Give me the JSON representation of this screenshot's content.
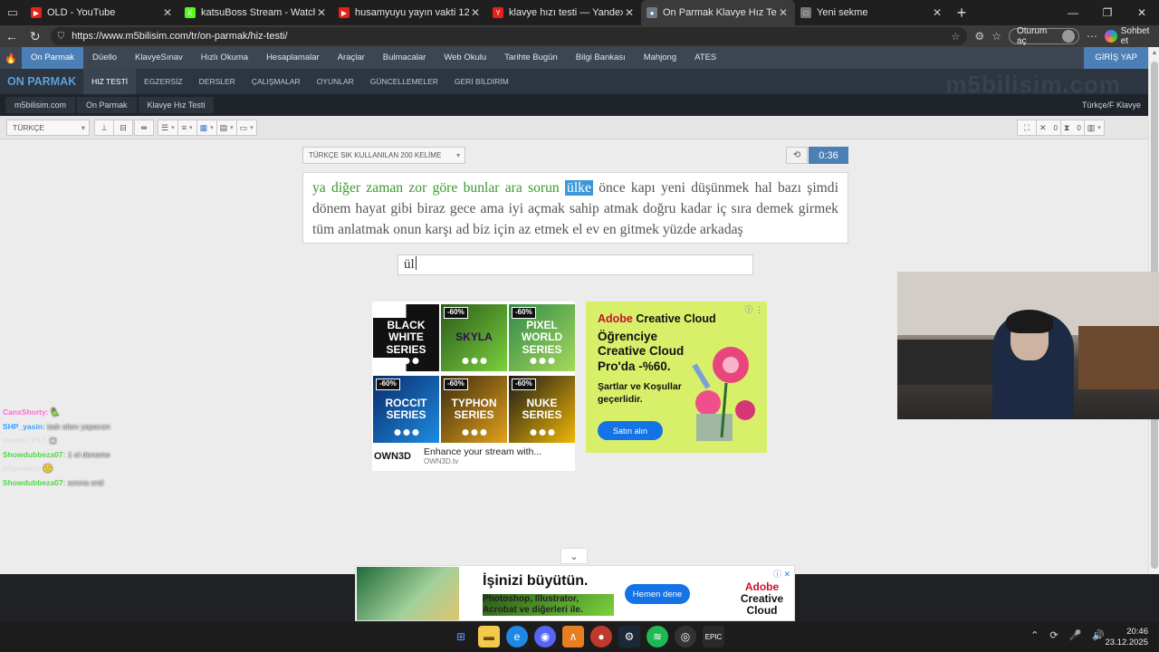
{
  "browser": {
    "tabs": [
      {
        "title": "OLD - YouTube",
        "fav_color": "#e62117",
        "fav": "▶",
        "active": false
      },
      {
        "title": "katsuBoss Stream - Watch Live on",
        "fav_color": "#53fc18",
        "fav": "K",
        "active": false
      },
      {
        "title": "husamyuyu yayın vakti 12 - YouTu",
        "fav_color": "#e62117",
        "fav": "▶",
        "active": false
      },
      {
        "title": "klavye hızı testi — Yandex: 104 bin",
        "fav_color": "#e62117",
        "fav": "Y",
        "active": false
      },
      {
        "title": "On Parmak Klavye Hız Testi | m5bi",
        "fav_color": "#6b7b8c",
        "fav": "●",
        "active": true
      },
      {
        "title": "Yeni sekme",
        "fav_color": "#777777",
        "fav": "□",
        "active": false
      }
    ],
    "url": "https://www.m5bilisim.com/tr/on-parmak/hiz-testi/",
    "signin_label": "Oturum aç",
    "copilot_label": "Sohbet et"
  },
  "site": {
    "menu": [
      "On Parmak",
      "Düello",
      "KlavyeSınav",
      "Hızlı Okuma",
      "Hesaplamalar",
      "Araçlar",
      "Bulmacalar",
      "Web Okulu",
      "Tarihte Bugün",
      "Bilgi Bankası",
      "Mahjong",
      "ATES"
    ],
    "login": "GİRİŞ YAP",
    "brand": "ON PARMAK",
    "subnav": [
      "HIZ TESTİ",
      "EGZERSİZ",
      "DERSLER",
      "ÇALIŞMALAR",
      "OYUNLAR",
      "GÜNCELLEMELER",
      "GERİ BİLDİRİM"
    ],
    "watermark": "m5bilisim.com",
    "breadcrumb": [
      "m5bilisim.com",
      "On Parmak",
      "Klavye Hız Testi"
    ],
    "keyboard_label": "Türkçe/F Klavye"
  },
  "toolbar": {
    "language": "TÜRKÇE",
    "counter_errors": "0",
    "counter_time": "0"
  },
  "test": {
    "word_set": "TÜRKÇE SIK KULLANILAN 200 KELİME",
    "timer": "0:36",
    "typed_words": [
      "ya",
      "diğer",
      "zaman",
      "zor",
      "göre",
      "bunlar",
      "ara",
      "sorun"
    ],
    "current_word": "ülke",
    "pending_words": [
      "önce",
      "kapı",
      "yeni",
      "düşünmek",
      "hal",
      "bazı",
      "şimdi",
      "dönem",
      "hayat",
      "gibi",
      "biraz",
      "gece",
      "ama",
      "iyi",
      "açmak",
      "sahip",
      "atmak",
      "doğru",
      "kadar",
      "iç",
      "sıra",
      "demek",
      "girmek",
      "tüm",
      "anlatmak",
      "onun",
      "karşı",
      "ad",
      "biz",
      "için",
      "az",
      "etmek",
      "el",
      "ev",
      "en",
      "gitmek",
      "yüzde",
      "arkadaş"
    ],
    "input_value": "ül"
  },
  "ads": {
    "own3d": {
      "tiles": [
        {
          "label": "BLACK WHITE SERIES",
          "pct": ""
        },
        {
          "label": "SKYLA",
          "pct": "-60%"
        },
        {
          "label": "PIXEL WORLD SERIES",
          "pct": "-60%"
        },
        {
          "label": "ROCCIT SERIES",
          "pct": "-60%"
        },
        {
          "label": "TYPHON SERIES",
          "pct": "-60%"
        },
        {
          "label": "NUKE SERIES",
          "pct": "-60%"
        }
      ],
      "logo": "OWN3D",
      "text": "Enhance your stream with...",
      "domain": "OWN3D.tv"
    },
    "adobe": {
      "brand_a": "Adobe",
      "brand_b": "Creative Cloud",
      "headline": "Öğrenciye Creative Cloud Pro'da -%60.",
      "sub": "Şartlar ve Koşullar geçerlidir.",
      "button": "Satın alın"
    },
    "bottom": {
      "title": "İşinizi büyütün.",
      "text": "Photoshop, Illustrator, Acrobat ve diğerleri ile.",
      "button": "Hemen dene",
      "brand_a": "Adobe",
      "brand_b": "Creative Cloud"
    }
  },
  "chat": [
    {
      "user": "CanxShorty:",
      "color": "#ff6ad5",
      "msg": "🦜"
    },
    {
      "user": "SHP_yasin:",
      "color": "#3aa0ff",
      "msg": "tadı olanı yapacan"
    },
    {
      "user": "switch_7S7:",
      "color": "#dddddd",
      "msg": "▣"
    },
    {
      "user": "Showdubbeza07:",
      "color": "#52d64a",
      "msg": "1 el deneme"
    },
    {
      "user": "elspontex:",
      "color": "#dddddd",
      "msg": "🙂"
    },
    {
      "user": "Showdubbeza07:",
      "color": "#52d64a",
      "msg": "sınına ordi"
    }
  ],
  "taskbar": {
    "time": "20:46",
    "date": "23.12.2025"
  }
}
